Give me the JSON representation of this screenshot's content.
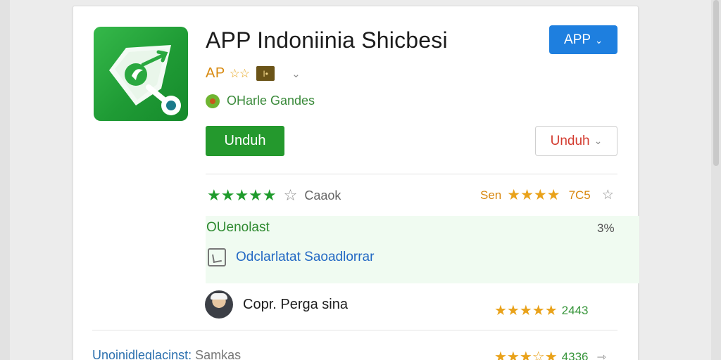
{
  "app": {
    "title": "APP Indoniinia Shicbesi",
    "app_button_label": "APP",
    "rating_prefix": "AP",
    "rating_stars": "☆☆",
    "badge_text": "I•",
    "developer": "OHarle Gandes"
  },
  "actions": {
    "install_primary": "Unduh",
    "install_secondary": "Unduh"
  },
  "ratings": {
    "green_stars": "★★★★★",
    "green_label": "Caaok",
    "orange_prefix": "Sen",
    "orange_stars": "★★★★",
    "orange_count": "7C5"
  },
  "panel": {
    "label": "OUenolast",
    "percent": "3%",
    "link_text": "Odclarlatat Saoadlorrar"
  },
  "review": {
    "name": "Copr. Perga sina",
    "stars": "★★★★★",
    "count": "2443"
  },
  "footer": {
    "label": "Unoinidleglacinst:",
    "sub_label": "Samkas",
    "stars": "★★★☆★",
    "count": "4336"
  },
  "icons": [
    "app-logo-icon",
    "chevron-down-icon",
    "developer-icon",
    "star-outline-icon",
    "link-icon",
    "avatar",
    "share-arrow-icon"
  ],
  "colors": {
    "accent_blue": "#1e7fdf",
    "install_green": "#24992d",
    "star_green": "#1f9b2c",
    "star_orange": "#e9a21a",
    "link_blue": "#2369c4",
    "secondary_red": "#d33b2f"
  }
}
